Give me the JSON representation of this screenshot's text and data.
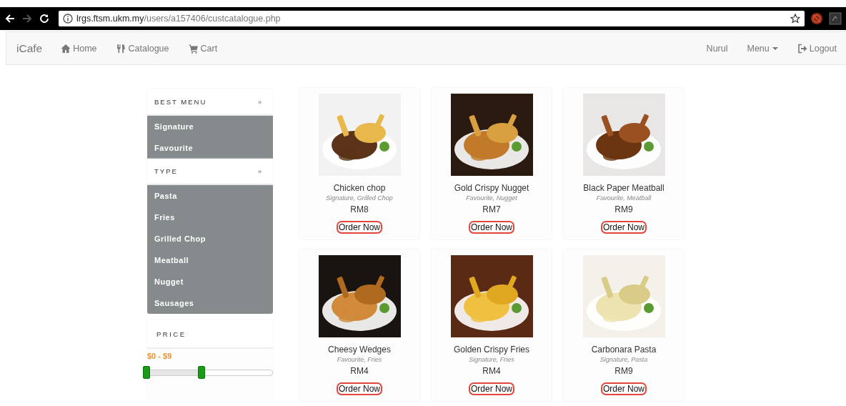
{
  "browser": {
    "address_host": "lrgs.ftsm.ukm.my",
    "address_path": "/users/a157406/custcatalogue.php"
  },
  "navbar": {
    "brand": "iCafe",
    "links": [
      {
        "label": "Home"
      },
      {
        "label": "Catalogue"
      },
      {
        "label": "Cart"
      }
    ],
    "right": [
      {
        "label": "Nurul",
        "kind": "text"
      },
      {
        "label": "Menu",
        "kind": "dropdown"
      },
      {
        "label": "Logout",
        "kind": "logout"
      }
    ]
  },
  "sidebar": {
    "sections": [
      {
        "title": "BEST MENU",
        "marker": "»",
        "items": [
          "Signature",
          "Favourite"
        ]
      },
      {
        "title": "TYPE",
        "marker": "»",
        "items": [
          "Pasta",
          "Fries",
          "Grilled Chop",
          "Meatball",
          "Nugget",
          "Sausages"
        ]
      }
    ],
    "price": {
      "title": "PRICE",
      "range_label": "$0 - $9",
      "handles": [
        {
          "level": 0
        },
        {
          "level": 0.45
        }
      ]
    }
  },
  "products": [
    {
      "name": "Chicken chop",
      "tags": "Signature, Grilled Chop",
      "price": "RM8",
      "button": "Order Now"
    },
    {
      "name": "Gold Crispy Nugget",
      "tags": "Favourite, Nugget",
      "price": "RM7",
      "button": "Order Now"
    },
    {
      "name": "Black Paper Meatball",
      "tags": "Favourite, Meatball",
      "price": "RM9",
      "button": "Order Now"
    },
    {
      "name": "Cheesy Wedges",
      "tags": "Favourite, Fries",
      "price": "RM4",
      "button": "Order Now"
    },
    {
      "name": "Golden Crispy Fries",
      "tags": "Signature, Fries",
      "price": "RM4",
      "button": "Order Now"
    },
    {
      "name": "Carbonara Pasta",
      "tags": "Signature, Pasta",
      "price": "RM9",
      "button": "Order Now"
    }
  ]
}
